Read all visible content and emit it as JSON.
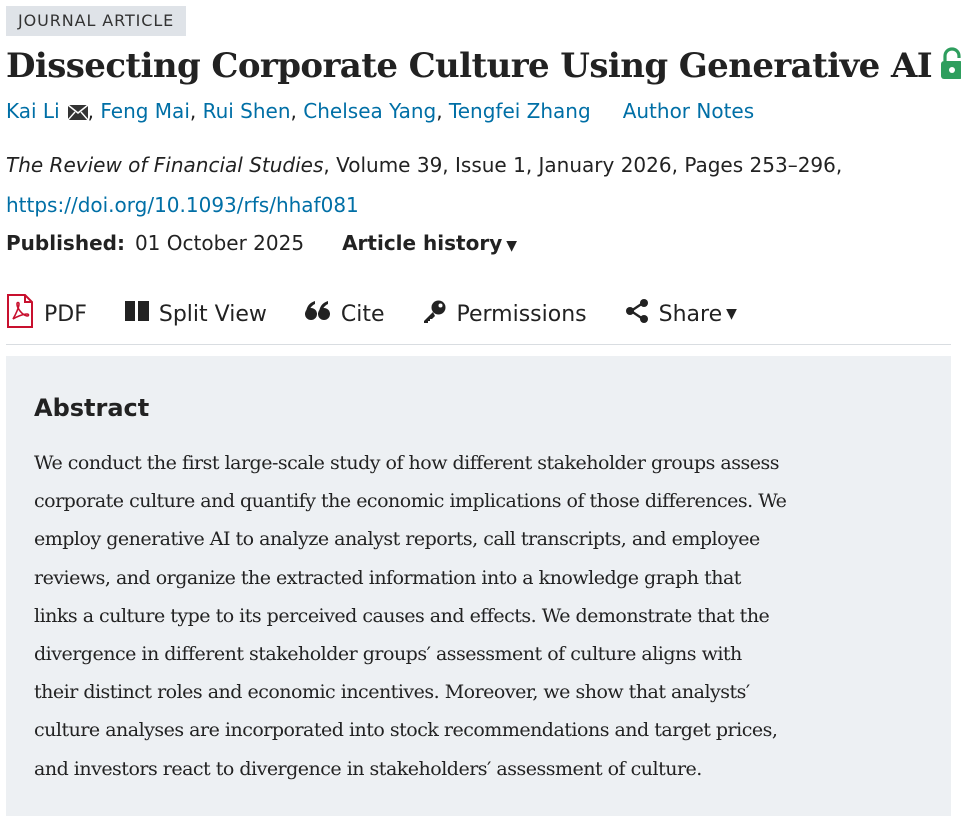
{
  "badge": "JOURNAL ARTICLE",
  "title": "Dissecting Corporate Culture Using Generative AI",
  "authors": {
    "names": [
      "Kai Li",
      "Feng Mai",
      "Rui Shen",
      "Chelsea Yang",
      "Tengfei Zhang"
    ],
    "author_notes": "Author Notes"
  },
  "citation": {
    "journal": "The Review of Financial Studies",
    "details": ", Volume 39, Issue 1, January 2026, Pages 253–296,",
    "doi": "https://doi.org/10.1093/rfs/hhaf081"
  },
  "published": {
    "label": "Published:",
    "date": "01 October 2025",
    "history_label": "Article history",
    "history_caret": "▼"
  },
  "toolbar": {
    "pdf": "PDF",
    "split_view": "Split View",
    "cite": "Cite",
    "permissions": "Permissions",
    "share": "Share",
    "share_caret": "▼"
  },
  "abstract": {
    "heading": "Abstract",
    "lines": [
      "We conduct the first large-scale study of how different stakeholder groups assess",
      "corporate culture and quantify the economic implications of those differences. We",
      "employ generative AI to analyze analyst reports, call transcripts, and employee",
      "reviews, and organize the extracted information into a knowledge graph that",
      "links a culture type to its perceived causes and effects. We demonstrate that the",
      "divergence in different stakeholder groups′ assessment of culture aligns with",
      "their distinct roles and economic incentives. Moreover, we show that analysts′",
      "culture analyses are incorporated into stock recommendations and target prices,",
      "and investors react to divergence in stakeholders′ assessment of culture."
    ]
  },
  "colors": {
    "link": "#006fa6",
    "open_access_lock": "#2e9e5e",
    "pdf_icon": "#c8102e",
    "abstract_bg": "#edf0f3",
    "badge_bg": "#dfe3e8"
  },
  "icons": [
    "open-access-lock-icon",
    "mail-icon",
    "pdf-icon",
    "split-view-icon",
    "quote-icon",
    "key-icon",
    "share-icon"
  ]
}
